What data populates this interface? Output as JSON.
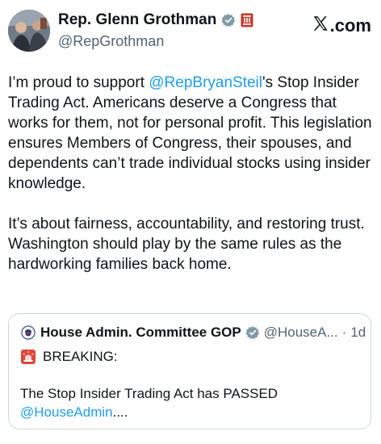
{
  "author": {
    "display_name": "Rep. Glenn Grothman",
    "handle": "@RepGrothman"
  },
  "brand": {
    "label": ".com"
  },
  "tweet": {
    "p1_before": "I’m proud to support ",
    "p1_mention": "@RepBryanSteil",
    "p1_after": "'s Stop Insider Trading Act. Americans deserve a Congress that works for them, not for personal profit. This legislation ensures Members of Congress, their spouses, and dependents can’t trade individual stocks using insider knowledge.",
    "p2": "It’s about fairness, accountability, and restoring trust. Washington should play by the same rules as the hardworking families back home."
  },
  "quote": {
    "display_name": "House Admin. Committee GOP",
    "handle": "@HouseA...",
    "separator": "·",
    "time": "1d",
    "breaking": "BREAKING:",
    "text": "The Stop Insider Trading Act has PASSED",
    "mention": "@HouseAdmin",
    "mention_suffix": "...."
  },
  "colors": {
    "link": "#1d9bf0",
    "muted": "#536471",
    "verified_badge": "#829aab",
    "congress_badge": "#c0392b",
    "border": "#cfd9de"
  },
  "icons": {
    "verified": "verified-badge-icon",
    "congress": "congress-seal-icon",
    "x_logo": "x-logo-icon",
    "siren": "siren-icon"
  }
}
